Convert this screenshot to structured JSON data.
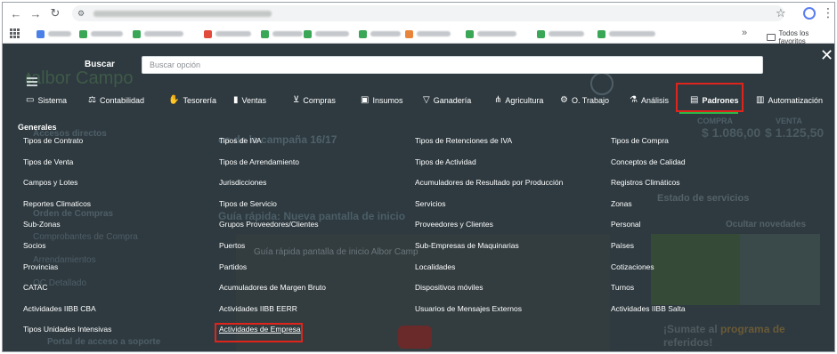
{
  "browser": {
    "bookmarks_folder": "Todos los favoritos"
  },
  "overlay": {
    "search_label": "Buscar",
    "search_placeholder": "Buscar opción",
    "close_icon": "close-icon"
  },
  "menu": {
    "items": [
      {
        "label": "Sistema",
        "icon": "monitor-icon",
        "glyph": "▭"
      },
      {
        "label": "Contabilidad",
        "icon": "scale-icon",
        "glyph": "⚖"
      },
      {
        "label": "Tesorería",
        "icon": "hand-money-icon",
        "glyph": "✋"
      },
      {
        "label": "Ventas",
        "icon": "bar-chart-icon",
        "glyph": "▮"
      },
      {
        "label": "Compras",
        "icon": "cart-icon",
        "glyph": "⊻"
      },
      {
        "label": "Insumos",
        "icon": "box-icon",
        "glyph": "▣"
      },
      {
        "label": "Ganadería",
        "icon": "cow-icon",
        "glyph": "▽"
      },
      {
        "label": "Agricultura",
        "icon": "wheat-icon",
        "glyph": "⋔"
      },
      {
        "label": "O. Trabajo",
        "icon": "tractor-icon",
        "glyph": "⚙"
      },
      {
        "label": "Análisis",
        "icon": "analysis-icon",
        "glyph": "⚗"
      },
      {
        "label": "Padrones",
        "icon": "clipboard-icon",
        "glyph": "▤"
      },
      {
        "label": "Automatización",
        "icon": "automation-icon",
        "glyph": "▥"
      }
    ],
    "active": "Padrones"
  },
  "padrones": {
    "group_title": "Generales",
    "columns": [
      [
        "Tipos de Contrato",
        "Tipos de Venta",
        "Campos y Lotes",
        "Reportes Climaticos",
        "Sub-Zonas",
        "Socios",
        "Provincias",
        "CATAC",
        "Actividades IIBB CBA",
        "Tipos Unidades Intensivas"
      ],
      [
        "Tipos de IVA",
        "Tipos de Arrendamiento",
        "Jurisdicciones",
        "Tipos de Servicio",
        "Grupos Proveedores/Clientes",
        "Puertos",
        "Partidos",
        "Acumuladores de Margen Bruto",
        "Actividades IIBB EERR",
        "Actividades de Empresa"
      ],
      [
        "Tipos de Retenciones de IVA",
        "Tipos de Actividad",
        "Acumuladores de Resultado por Producción",
        "Servicios",
        "Proveedores y Clientes",
        "Sub-Empresas de Maquinarias",
        "Localidades",
        "Dispositivos móviles",
        "Usuarios de Mensajes Externos"
      ],
      [
        "Tipos de Compra",
        "Conceptos de Calidad",
        "Registros Climáticos",
        "Zonas",
        "Personal",
        "Países",
        "Cotizaciones",
        "Turnos",
        "Actividades IIBB Salta"
      ]
    ],
    "highlighted_option": "Actividades de Empresa"
  },
  "background": {
    "logo": "albor Campo",
    "campaign_title": "os de la campaña 16/17",
    "guide_heading": "Guía rápida: Nueva pantalla de inicio",
    "video_title": "Guía rápida pantalla de inicio Albor Camp",
    "services_title": "Estado de servicios",
    "hide_news": "Ocultar novedades",
    "compra": "COMPRA",
    "venta": "VENTA",
    "dolar_compra": "$ 1.086,00",
    "dolar_venta": "$ 1.125,50",
    "sumate_prefix": "¡Sumate al ",
    "sumate_highlight": "programa de",
    "sumate_suffix": "referidos!",
    "side_items": [
      "Accesos directos",
      "Orden de Compras",
      "Comprobantes de Compra",
      "Arrendamientos",
      "OC Detallado",
      "Portal de acceso a soporte"
    ]
  }
}
